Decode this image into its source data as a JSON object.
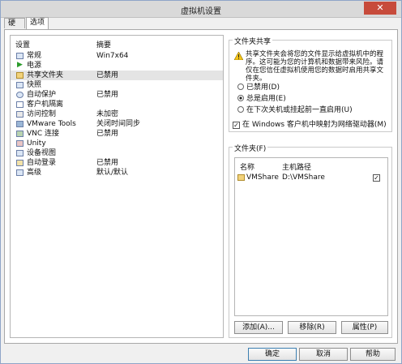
{
  "window": {
    "title": "虚拟机设置",
    "close_glyph": "✕"
  },
  "tabs": [
    {
      "label": "硬件"
    },
    {
      "label": "选项"
    }
  ],
  "list": {
    "header_setting": "设置",
    "header_summary": "摘要",
    "rows": [
      {
        "name": "常规",
        "value": "Win7x64"
      },
      {
        "name": "电源",
        "value": ""
      },
      {
        "name": "共享文件夹",
        "value": "已禁用"
      },
      {
        "name": "快照",
        "value": ""
      },
      {
        "name": "自动保护",
        "value": "已禁用"
      },
      {
        "name": "客户机隔离",
        "value": ""
      },
      {
        "name": "访问控制",
        "value": "未加密"
      },
      {
        "name": "VMware Tools",
        "value": "关闭时间同步"
      },
      {
        "name": "VNC 连接",
        "value": "已禁用"
      },
      {
        "name": "Unity",
        "value": ""
      },
      {
        "name": "设备视图",
        "value": ""
      },
      {
        "name": "自动登录",
        "value": "已禁用"
      },
      {
        "name": "高级",
        "value": "默认/默认"
      }
    ]
  },
  "sharing": {
    "title": "文件夹共享",
    "warning": "共享文件夹会将您的文件显示给虚拟机中的程序。这可能为您的计算机和数据带来风险。请仅在您信任虚拟机使用您的数据时启用共享文件夹。",
    "opt_disabled": "已禁用(D)",
    "opt_always": "总是启用(E)",
    "opt_until": "在下次关机或挂起前一直启用(U)",
    "map_drive": "在 Windows 客户机中映射为网络驱动器(M)"
  },
  "folders": {
    "title": "文件夹(F)",
    "col_name": "名称",
    "col_path": "主机路径",
    "items": [
      {
        "name": "VMShare",
        "path": "D:\\VMShare",
        "checked": "✓"
      }
    ],
    "add": "添加(A)...",
    "remove": "移除(R)",
    "props": "属性(P)"
  },
  "footer": {
    "ok": "确定",
    "cancel": "取消",
    "help": "帮助"
  }
}
